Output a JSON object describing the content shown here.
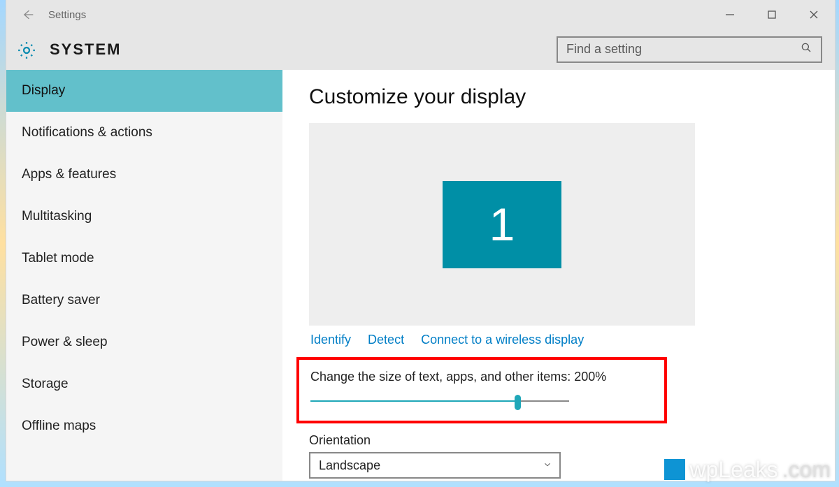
{
  "window": {
    "title": "Settings",
    "section": "SYSTEM"
  },
  "search": {
    "placeholder": "Find a setting"
  },
  "sidebar": {
    "items": [
      {
        "label": "Display",
        "selected": true
      },
      {
        "label": "Notifications & actions",
        "selected": false
      },
      {
        "label": "Apps & features",
        "selected": false
      },
      {
        "label": "Multitasking",
        "selected": false
      },
      {
        "label": "Tablet mode",
        "selected": false
      },
      {
        "label": "Battery saver",
        "selected": false
      },
      {
        "label": "Power & sleep",
        "selected": false
      },
      {
        "label": "Storage",
        "selected": false
      },
      {
        "label": "Offline maps",
        "selected": false
      }
    ]
  },
  "main": {
    "heading": "Customize your display",
    "monitor_number": "1",
    "links": {
      "identify": "Identify",
      "detect": "Detect",
      "wireless": "Connect to a wireless display"
    },
    "scale": {
      "label": "Change the size of text, apps, and other items: 200%",
      "value_percent": 200,
      "slider_fill_percent": 80
    },
    "orientation": {
      "label": "Orientation",
      "value": "Landscape"
    }
  },
  "watermark": {
    "brand": "wpLeaks",
    "tld": ".com"
  }
}
